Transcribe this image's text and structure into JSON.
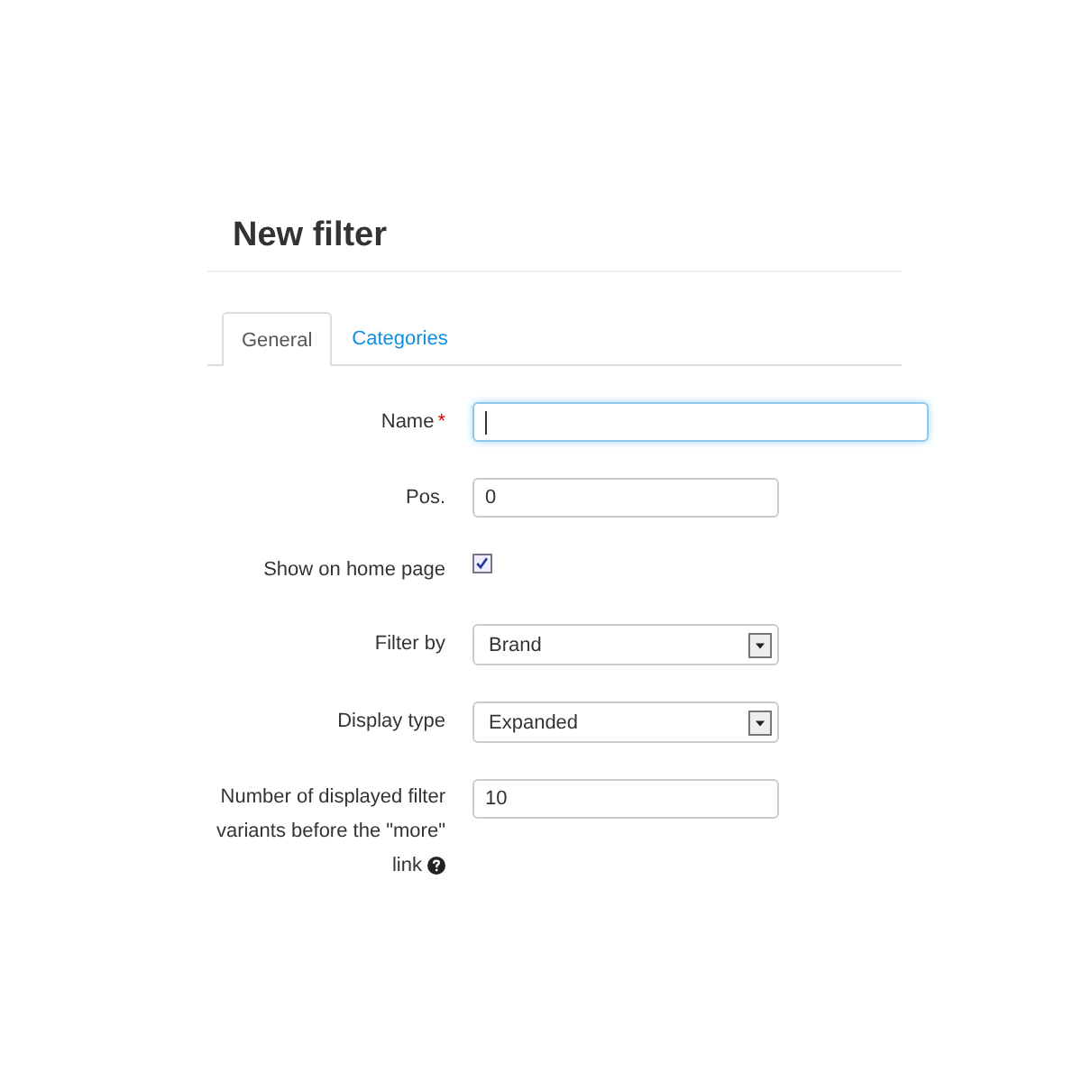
{
  "title": "New filter",
  "tabs": [
    {
      "label": "General",
      "selected": true
    },
    {
      "label": "Categories",
      "selected": false
    }
  ],
  "fields": [
    {
      "kind": "text",
      "label": "Name",
      "required_mark": "*",
      "focused": true
    },
    {
      "kind": "text",
      "label": "Pos.",
      "focused": false,
      "value": "0"
    },
    {
      "kind": "checkbox",
      "label": "Show on home page",
      "checked": true
    },
    {
      "kind": "select",
      "label": "Filter by",
      "value": "Brand"
    },
    {
      "kind": "select",
      "label": "Display type",
      "value": "Expanded"
    },
    {
      "kind": "text",
      "label": "Number of displayed filter variants before the \"more\" link",
      "help": true,
      "focused": false,
      "value": "10"
    }
  ]
}
